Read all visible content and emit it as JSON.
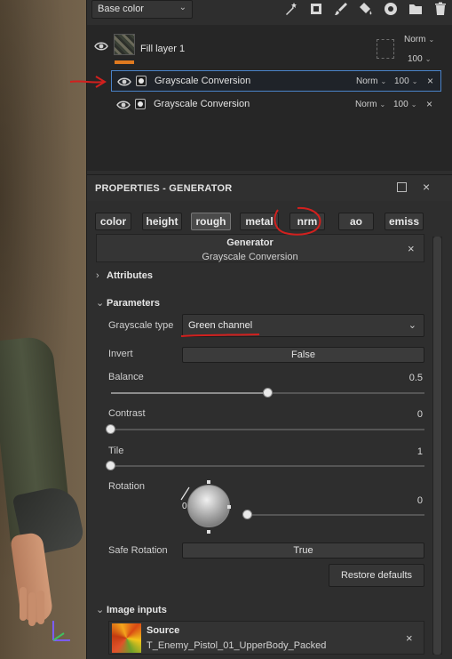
{
  "toolbar": {
    "channel": "Base color",
    "icons": [
      "magic-wand-icon",
      "fill-effect-icon",
      "paint-brush-icon",
      "paint-bucket-icon",
      "color-picker-icon",
      "folder-icon",
      "trash-icon"
    ]
  },
  "layers": {
    "fill_layer": {
      "name": "Fill layer 1",
      "blend": "Norm",
      "opacity": "100"
    },
    "effects": [
      {
        "name": "Grayscale Conversion",
        "blend": "Norm",
        "opacity": "100",
        "selected": true
      },
      {
        "name": "Grayscale Conversion",
        "blend": "Norm",
        "opacity": "100",
        "selected": false
      }
    ]
  },
  "properties": {
    "title": "PROPERTIES - GENERATOR",
    "channels": [
      "color",
      "height",
      "rough",
      "metal",
      "nrm",
      "ao",
      "emiss"
    ],
    "active_channel": "rough",
    "generator": {
      "title": "Generator",
      "name": "Grayscale Conversion"
    },
    "sections": {
      "attributes": "Attributes",
      "parameters": "Parameters",
      "image_inputs": "Image inputs"
    },
    "params": {
      "grayscale_type_label": "Grayscale type",
      "grayscale_type_value": "Green channel",
      "invert_label": "Invert",
      "invert_value": "False",
      "balance_label": "Balance",
      "balance_value": "0.5",
      "contrast_label": "Contrast",
      "contrast_value": "0",
      "tile_label": "Tile",
      "tile_value": "1",
      "rotation_label": "Rotation",
      "rotation_dial_value": "0",
      "rotation_value": "0",
      "safe_rotation_label": "Safe Rotation",
      "safe_rotation_value": "True"
    },
    "slider_levels": {
      "balance": 0.5,
      "contrast": 0,
      "tile": 0,
      "rotation": 0
    },
    "restore_label": "Restore defaults",
    "source": {
      "title": "Source",
      "file": "T_Enemy_Pistol_01_UpperBody_Packed"
    }
  },
  "colors": {
    "accent": "#4a83c9",
    "fill_bar": "#e07a1f",
    "annotation": "#d2201e"
  }
}
